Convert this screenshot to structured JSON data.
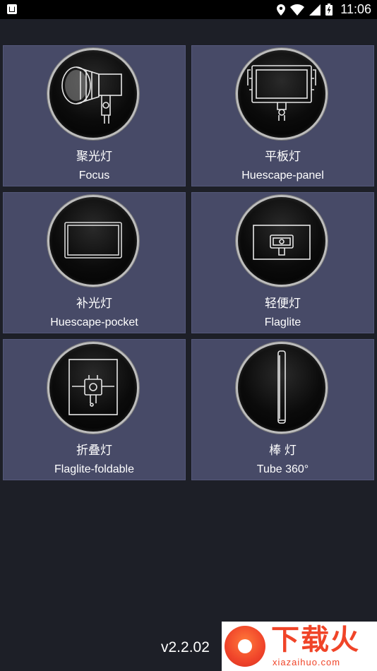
{
  "status_bar": {
    "time": "11:06",
    "icons": [
      "app-notification-icon",
      "location-icon",
      "wifi-icon",
      "signal-icon",
      "battery-icon"
    ]
  },
  "tiles": [
    {
      "cn": "聚光灯",
      "en": "Focus",
      "icon": "spotlight-icon"
    },
    {
      "cn": "平板灯",
      "en": "Huescape-panel",
      "icon": "panel-light-icon"
    },
    {
      "cn": "补光灯",
      "en": "Huescape-pocket",
      "icon": "pocket-light-icon"
    },
    {
      "cn": "轻便灯",
      "en": "Flaglite",
      "icon": "flaglite-icon"
    },
    {
      "cn": "折叠灯",
      "en": "Flaglite-foldable",
      "icon": "foldable-light-icon"
    },
    {
      "cn": "棒 灯",
      "en": "Tube 360°",
      "icon": "tube-light-icon"
    }
  ],
  "version": "v2.2.02",
  "watermark": {
    "text": "下载火",
    "url": "xiazaihuo.com"
  },
  "colors": {
    "background": "#1d1f27",
    "tile": "#474a67",
    "accent": "#f04428"
  }
}
